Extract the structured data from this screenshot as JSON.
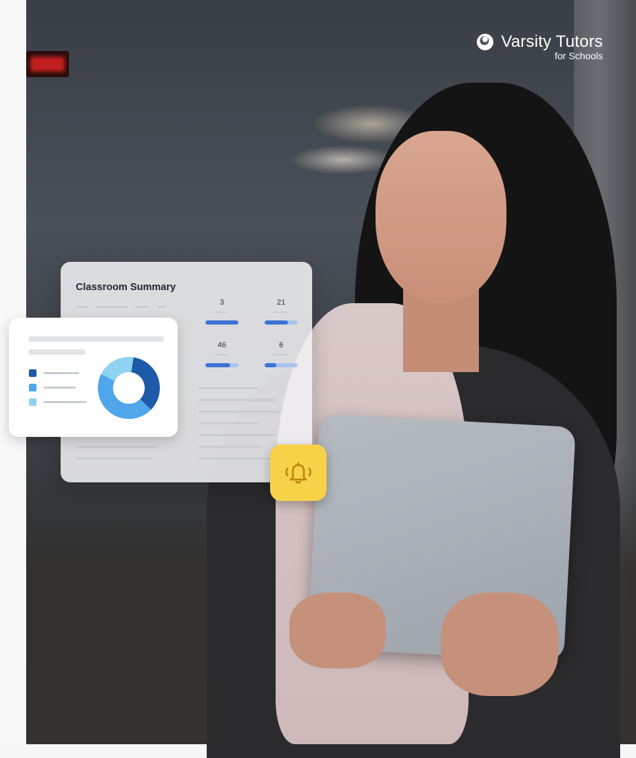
{
  "brand": {
    "name": "Varsity Tutors",
    "sub": "for Schools"
  },
  "summary_card": {
    "title": "Classroom Summary",
    "stats": [
      {
        "value": "3",
        "fill": 1.0
      },
      {
        "value": "21",
        "fill": 0.7
      },
      {
        "value": "46",
        "fill": 0.75
      },
      {
        "value": "6",
        "fill": 0.35
      }
    ]
  },
  "donut_card": {
    "legend_colors": [
      "#1d5aa8",
      "#4fa6ea",
      "#8fd3f1"
    ],
    "segments": [
      {
        "color": "#1d5aa8",
        "fraction": 0.35
      },
      {
        "color": "#4fa6ea",
        "fraction": 0.45
      },
      {
        "color": "#8fd3f1",
        "fraction": 0.2
      }
    ]
  },
  "icons": {
    "bell": "bell-icon",
    "logo": "varsity-tutors-logo"
  },
  "colors": {
    "bell_bg": "#f7d148",
    "bell_stroke": "#b8860b",
    "bar_fill": "#3d73d6"
  }
}
